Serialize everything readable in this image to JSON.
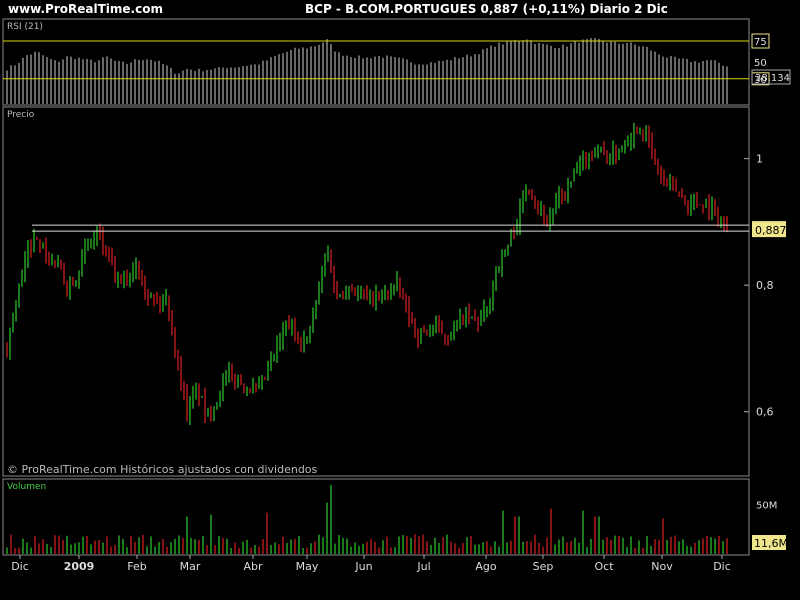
{
  "header": {
    "site": "www.ProRealTime.com",
    "title": "BCP - B.COM.PORTUGUES    0,887 (+0,11%)    Diario  2 Dic"
  },
  "panels": {
    "rsi_label": "RSI (21)",
    "price_label": "Precio",
    "volume_label": "Volumen",
    "watermark": "© ProRealTime.com  Históricos ajustados con dividendos"
  },
  "colors": {
    "up": "#2ecc2e",
    "down": "#dd2222",
    "rsi": "#cfcfcf",
    "level_line": "#d8d800",
    "grid_border": "#8a8a8a",
    "last_box": "#f0e68c"
  },
  "chart_data": [
    {
      "type": "line",
      "name": "RSI (21)",
      "y_ticks": [
        "75",
        "50",
        "30"
      ],
      "ylim": [
        0,
        100
      ],
      "levels": [
        75,
        30
      ],
      "last_value": "38,134",
      "points": [
        [
          0,
          42
        ],
        [
          10,
          48
        ],
        [
          20,
          58
        ],
        [
          30,
          62
        ],
        [
          40,
          55
        ],
        [
          50,
          50
        ],
        [
          60,
          56
        ],
        [
          70,
          55
        ],
        [
          80,
          52
        ],
        [
          90,
          51
        ],
        [
          100,
          56
        ],
        [
          110,
          50
        ],
        [
          120,
          48
        ],
        [
          130,
          53
        ],
        [
          140,
          54
        ],
        [
          150,
          51
        ],
        [
          160,
          45
        ],
        [
          170,
          36
        ],
        [
          180,
          42
        ],
        [
          190,
          40
        ],
        [
          200,
          41
        ],
        [
          210,
          42
        ],
        [
          220,
          44
        ],
        [
          230,
          44
        ],
        [
          240,
          46
        ],
        [
          250,
          47
        ],
        [
          260,
          52
        ],
        [
          270,
          58
        ],
        [
          280,
          62
        ],
        [
          290,
          66
        ],
        [
          300,
          67
        ],
        [
          310,
          70
        ],
        [
          320,
          76
        ],
        [
          330,
          61
        ],
        [
          340,
          58
        ],
        [
          350,
          56
        ],
        [
          360,
          55
        ],
        [
          370,
          57
        ],
        [
          380,
          56
        ],
        [
          390,
          54
        ],
        [
          400,
          52
        ],
        [
          410,
          48
        ],
        [
          420,
          49
        ],
        [
          430,
          50
        ],
        [
          440,
          52
        ],
        [
          450,
          55
        ],
        [
          460,
          57
        ],
        [
          470,
          60
        ],
        [
          480,
          66
        ],
        [
          490,
          71
        ],
        [
          500,
          73
        ],
        [
          510,
          76
        ],
        [
          520,
          78
        ],
        [
          530,
          72
        ],
        [
          540,
          70
        ],
        [
          550,
          68
        ],
        [
          560,
          70
        ],
        [
          570,
          74
        ],
        [
          580,
          76
        ],
        [
          590,
          77
        ],
        [
          600,
          74
        ],
        [
          610,
          72
        ],
        [
          620,
          73
        ],
        [
          630,
          70
        ],
        [
          640,
          67
        ],
        [
          650,
          60
        ],
        [
          660,
          56
        ],
        [
          670,
          54
        ],
        [
          680,
          52
        ],
        [
          690,
          50
        ],
        [
          700,
          52
        ],
        [
          710,
          50
        ],
        [
          720,
          45
        ]
      ]
    },
    {
      "type": "candlestick",
      "name": "Precio",
      "y_ticks": [
        "1",
        "0,8",
        "0,6"
      ],
      "last_price": "0,887",
      "support_level": "0,887",
      "ylim": [
        0.5,
        1.08
      ],
      "x_ticks": [
        "Dic",
        "2009",
        "Feb",
        "Mar",
        "Abr",
        "May",
        "Jun",
        "Jul",
        "Ago",
        "Sep",
        "Oct",
        "Nov",
        "Dic"
      ],
      "path": [
        [
          0,
          0.7
        ],
        [
          10,
          0.78
        ],
        [
          20,
          0.85
        ],
        [
          30,
          0.88
        ],
        [
          40,
          0.84
        ],
        [
          50,
          0.83
        ],
        [
          60,
          0.8
        ],
        [
          70,
          0.82
        ],
        [
          80,
          0.86
        ],
        [
          90,
          0.88
        ],
        [
          100,
          0.85
        ],
        [
          110,
          0.8
        ],
        [
          120,
          0.81
        ],
        [
          130,
          0.84
        ],
        [
          140,
          0.79
        ],
        [
          150,
          0.77
        ],
        [
          160,
          0.78
        ],
        [
          170,
          0.68
        ],
        [
          180,
          0.6
        ],
        [
          190,
          0.64
        ],
        [
          200,
          0.59
        ],
        [
          210,
          0.62
        ],
        [
          220,
          0.66
        ],
        [
          230,
          0.65
        ],
        [
          240,
          0.64
        ],
        [
          250,
          0.63
        ],
        [
          260,
          0.66
        ],
        [
          270,
          0.7
        ],
        [
          280,
          0.74
        ],
        [
          290,
          0.72
        ],
        [
          300,
          0.71
        ],
        [
          310,
          0.78
        ],
        [
          320,
          0.86
        ],
        [
          330,
          0.78
        ],
        [
          340,
          0.8
        ],
        [
          350,
          0.79
        ],
        [
          360,
          0.78
        ],
        [
          370,
          0.78
        ],
        [
          380,
          0.79
        ],
        [
          390,
          0.8
        ],
        [
          400,
          0.76
        ],
        [
          410,
          0.72
        ],
        [
          420,
          0.73
        ],
        [
          430,
          0.73
        ],
        [
          440,
          0.72
        ],
        [
          450,
          0.74
        ],
        [
          460,
          0.75
        ],
        [
          470,
          0.74
        ],
        [
          480,
          0.76
        ],
        [
          490,
          0.83
        ],
        [
          500,
          0.86
        ],
        [
          510,
          0.9
        ],
        [
          520,
          0.96
        ],
        [
          530,
          0.93
        ],
        [
          540,
          0.9
        ],
        [
          550,
          0.93
        ],
        [
          560,
          0.95
        ],
        [
          570,
          0.98
        ],
        [
          580,
          1.0
        ],
        [
          590,
          1.02
        ],
        [
          600,
          1.0
        ],
        [
          610,
          1.01
        ],
        [
          620,
          1.03
        ],
        [
          630,
          1.05
        ],
        [
          640,
          1.04
        ],
        [
          650,
          0.98
        ],
        [
          660,
          0.96
        ],
        [
          670,
          0.95
        ],
        [
          680,
          0.93
        ],
        [
          690,
          0.93
        ],
        [
          700,
          0.93
        ],
        [
          710,
          0.91
        ],
        [
          720,
          0.887
        ]
      ]
    },
    {
      "type": "bar",
      "name": "Volumen",
      "y_ticks": [
        "50M"
      ],
      "last_volume": "11,6M",
      "ylim": [
        0,
        75
      ],
      "spikes": [
        [
          325,
          70
        ],
        [
          320,
          52
        ],
        [
          260,
          42
        ],
        [
          205,
          40
        ],
        [
          180,
          38
        ],
        [
          495,
          44
        ],
        [
          545,
          46
        ],
        [
          575,
          44
        ],
        [
          590,
          38
        ],
        [
          655,
          36
        ],
        [
          510,
          38
        ]
      ]
    }
  ]
}
